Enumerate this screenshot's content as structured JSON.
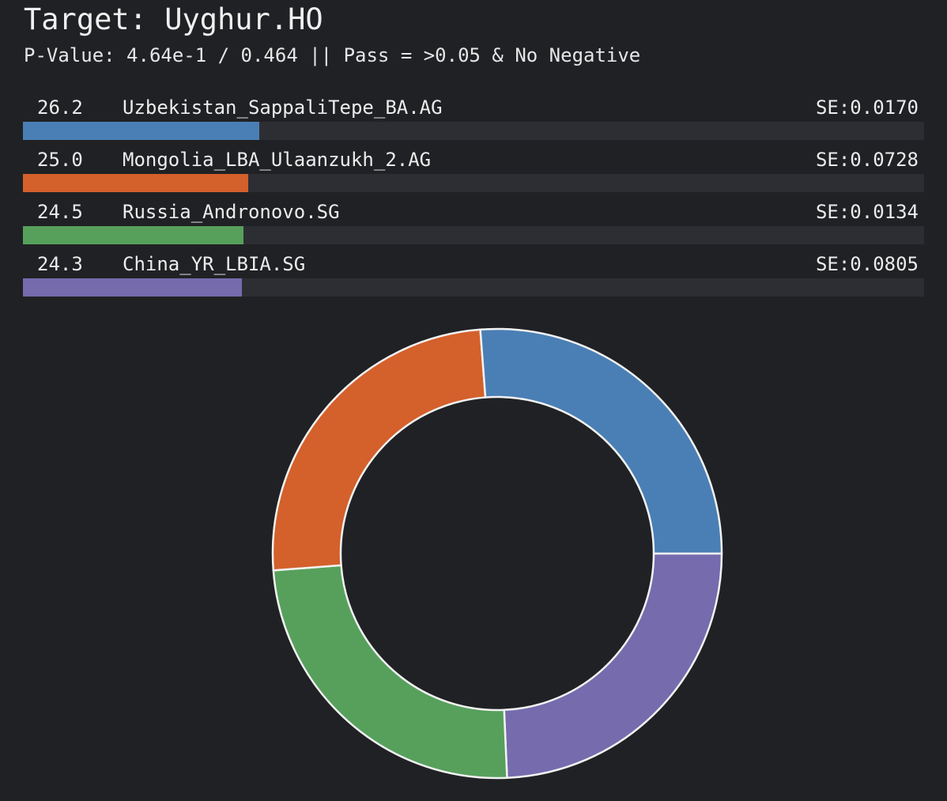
{
  "header": {
    "title": "Target: Uyghur.HO",
    "subtitle": "P-Value: 4.64e-1 / 0.464 || Pass = >0.05 & No Negative"
  },
  "chart_data": {
    "type": "pie",
    "variant": "donut",
    "bar_scale_max": 100,
    "segments": [
      {
        "percent_label": "26.2",
        "value": 26.2,
        "label": "Uzbekistan_SappaliTepe_BA.AG",
        "se_label": "SE:0.0170",
        "color": "#4a7fb5"
      },
      {
        "percent_label": "25.0",
        "value": 25.0,
        "label": "Mongolia_LBA_Ulaanzukh_2.AG",
        "se_label": "SE:0.0728",
        "color": "#d4602b"
      },
      {
        "percent_label": "24.5",
        "value": 24.5,
        "label": "Russia_Andronovo.SG",
        "se_label": "SE:0.0134",
        "color": "#56a05c"
      },
      {
        "percent_label": "24.3",
        "value": 24.3,
        "label": "China_YR_LBIA.SG",
        "se_label": "SE:0.0805",
        "color": "#756bad"
      }
    ]
  }
}
